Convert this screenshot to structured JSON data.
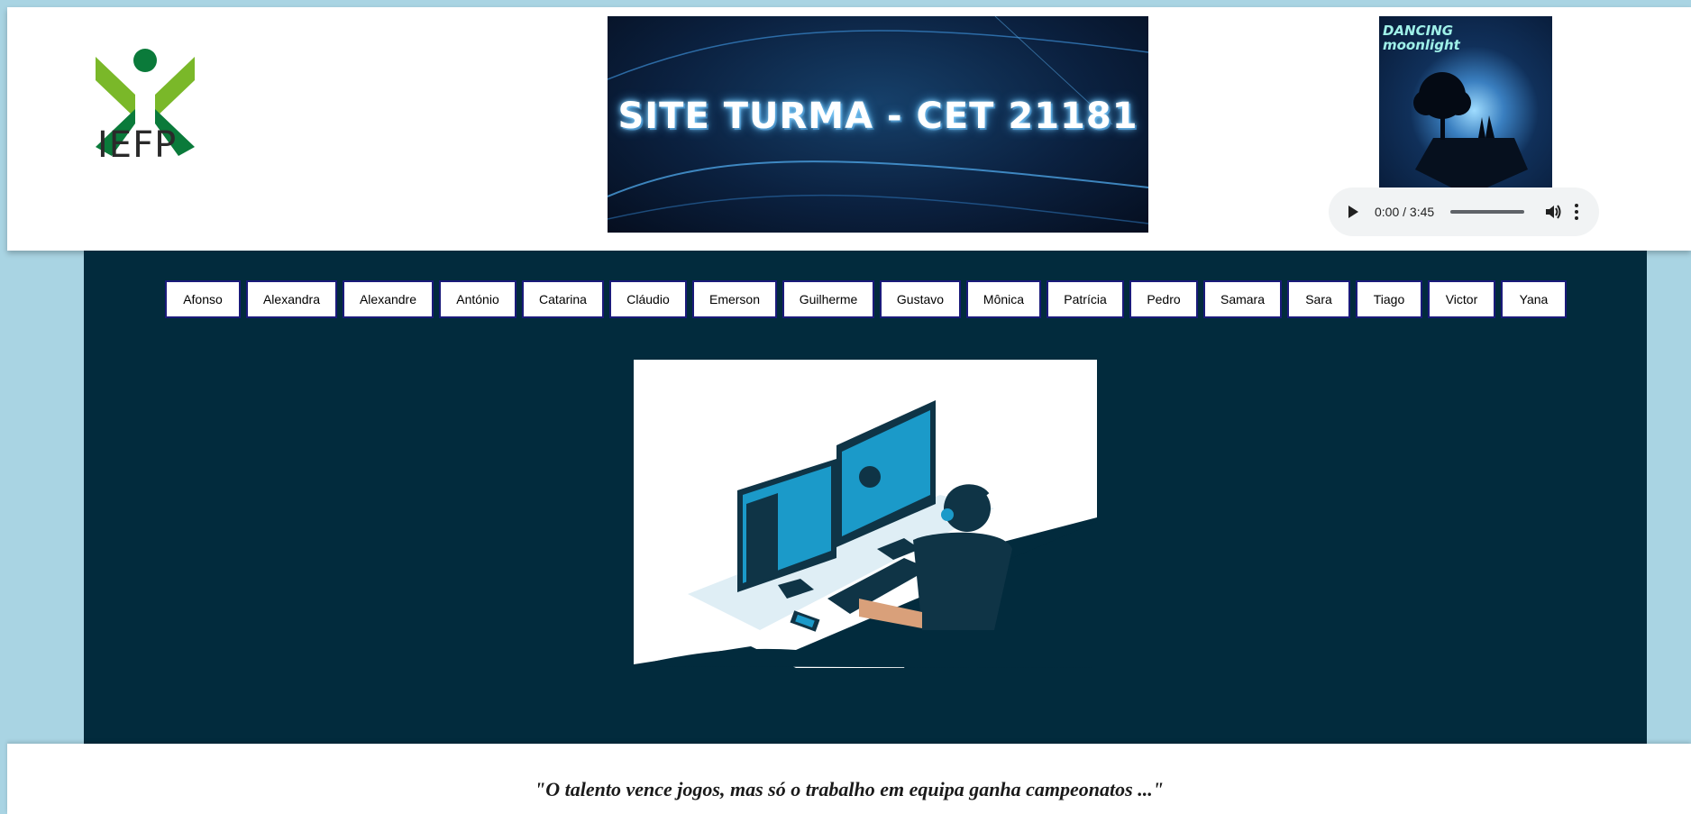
{
  "header": {
    "logo_text": "IEFP",
    "banner_title": "SITE TURMA - CET 21181",
    "album_title": "DANCING moonlight"
  },
  "audio": {
    "time": "0:00 / 3:45",
    "progress": 0
  },
  "nav": {
    "students": [
      "Afonso",
      "Alexandra",
      "Alexandre",
      "António",
      "Catarina",
      "Cláudio",
      "Emerson",
      "Guilherme",
      "Gustavo",
      "Mônica",
      "Patrícia",
      "Pedro",
      "Samara",
      "Sara",
      "Tiago",
      "Victor",
      "Yana"
    ]
  },
  "footer": {
    "quote": "\"O talento vence jogos, mas só o trabalho em equipa ganha campeonatos ...\""
  },
  "colors": {
    "page_bg": "#a9d4e3",
    "main_bg": "#022b3d",
    "nav_border": "#1a1a7a",
    "logo_dark_green": "#0a7a3a",
    "logo_light_green": "#7ab829"
  }
}
